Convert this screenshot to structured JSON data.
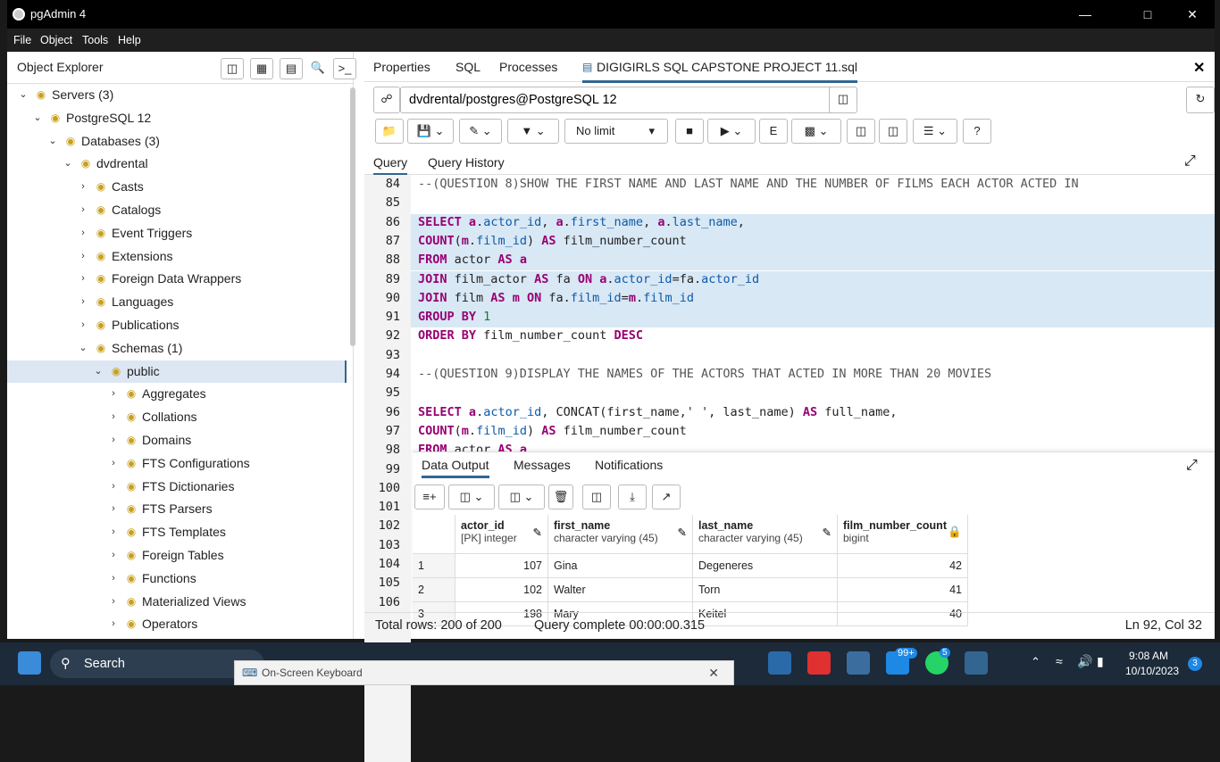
{
  "window": {
    "title": "pgAdmin 4"
  },
  "menu": [
    "File",
    "Object",
    "Tools",
    "Help"
  ],
  "explorer": {
    "title": "Object Explorer",
    "tree": [
      {
        "label": "Servers (3)",
        "depth": 0,
        "icon": "server-icon"
      },
      {
        "label": "PostgreSQL 12",
        "depth": 1,
        "icon": "elephant-icon"
      },
      {
        "label": "Databases (3)",
        "depth": 2,
        "icon": "database-icon"
      },
      {
        "label": "dvdrental",
        "depth": 3,
        "icon": "database-icon"
      },
      {
        "label": "Casts",
        "depth": 4,
        "icon": "cast-icon"
      },
      {
        "label": "Catalogs",
        "depth": 4,
        "icon": "catalog-icon"
      },
      {
        "label": "Event Triggers",
        "depth": 4,
        "icon": "event-trigger-icon"
      },
      {
        "label": "Extensions",
        "depth": 4,
        "icon": "extension-icon"
      },
      {
        "label": "Foreign Data Wrappers",
        "depth": 4,
        "icon": "fdw-icon"
      },
      {
        "label": "Languages",
        "depth": 4,
        "icon": "language-icon"
      },
      {
        "label": "Publications",
        "depth": 4,
        "icon": "publication-icon"
      },
      {
        "label": "Schemas (1)",
        "depth": 4,
        "icon": "schema-icon"
      },
      {
        "label": "public",
        "depth": 5,
        "icon": "schema-public-icon"
      },
      {
        "label": "Aggregates",
        "depth": 6,
        "icon": "aggregate-icon"
      },
      {
        "label": "Collations",
        "depth": 6,
        "icon": "collation-icon"
      },
      {
        "label": "Domains",
        "depth": 6,
        "icon": "domain-icon"
      },
      {
        "label": "FTS Configurations",
        "depth": 6,
        "icon": "fts-config-icon"
      },
      {
        "label": "FTS Dictionaries",
        "depth": 6,
        "icon": "fts-dict-icon"
      },
      {
        "label": "FTS Parsers",
        "depth": 6,
        "icon": "fts-parser-icon"
      },
      {
        "label": "FTS Templates",
        "depth": 6,
        "icon": "fts-template-icon"
      },
      {
        "label": "Foreign Tables",
        "depth": 6,
        "icon": "foreign-table-icon"
      },
      {
        "label": "Functions",
        "depth": 6,
        "icon": "function-icon"
      },
      {
        "label": "Materialized Views",
        "depth": 6,
        "icon": "mview-icon"
      },
      {
        "label": "Operators",
        "depth": 6,
        "icon": "operator-icon"
      }
    ]
  },
  "tabs": {
    "properties": "Properties",
    "sql": "SQL",
    "processes": "Processes",
    "file": "DIGIGIRLS SQL CAPSTONE PROJECT 11.sql"
  },
  "connection": "dvdrental/postgres@PostgreSQL 12",
  "limit": "No limit",
  "query_tabs": {
    "query": "Query",
    "history": "Query History"
  },
  "editor_lines": [
    {
      "n": "84",
      "html": "<span class='cm'>--(QUESTION 8)SHOW THE FIRST NAME AND LAST NAME AND THE NUMBER OF FILMS EACH ACTOR ACTED IN</span>"
    },
    {
      "n": "85",
      "html": ""
    },
    {
      "n": "86",
      "html": "<span class='kw'>SELECT</span> <span class='kw'>a</span>.<span class='ident'>actor_id</span>, <span class='kw'>a</span>.<span class='ident'>first_name</span>, <span class='kw'>a</span>.<span class='ident'>last_name</span>,",
      "hl": true
    },
    {
      "n": "87",
      "html": "<span class='kw'>COUNT</span>(<span class='kw'>m</span>.<span class='ident'>film_id</span>) <span class='kw'>AS</span> film_number_count",
      "hl": true
    },
    {
      "n": "88",
      "html": "<span class='kw'>FROM</span> actor <span class='kw'>AS</span> <span class='kw'>a</span>",
      "hl": true
    },
    {
      "n": "89",
      "html": "<span class='kw'>JOIN</span> film_actor <span class='kw'>AS</span> fa <span class='kw'>ON</span> <span class='kw'>a</span>.<span class='ident'>actor_id</span>=fa.<span class='ident'>actor_id</span>",
      "hl": true
    },
    {
      "n": "90",
      "html": "<span class='kw'>JOIN</span> film <span class='kw'>AS</span> <span class='kw'>m</span> <span class='kw'>ON</span> fa.<span class='ident'>film_id</span>=<span class='kw'>m</span>.<span class='ident'>film_id</span>",
      "hl": true
    },
    {
      "n": "91",
      "html": "<span class='kw'>GROUP BY</span> <span style='color:#1a7a2e'>1</span>",
      "hl": true
    },
    {
      "n": "92",
      "html": "<span class='kw'>ORDER BY</span> film_number_count <span class='kw'>DESC</span>"
    },
    {
      "n": "93",
      "html": ""
    },
    {
      "n": "94",
      "html": "<span class='cm'>--(QUESTION 9)DISPLAY THE NAMES OF THE ACTORS THAT ACTED IN MORE THAN 20 MOVIES</span>"
    },
    {
      "n": "95",
      "html": ""
    },
    {
      "n": "96",
      "html": "<span class='kw'>SELECT</span> <span class='kw'>a</span>.<span class='ident'>actor_id</span>, CONCAT(first_name,' ', last_name) <span class='kw'>AS</span> full_name,"
    },
    {
      "n": "97",
      "html": "<span class='kw'>COUNT</span>(<span class='kw'>m</span>.<span class='ident'>film_id</span>) <span class='kw'>AS</span> film_number_count"
    },
    {
      "n": "98",
      "html": "<span class='kw'>FROM</span> actor <span class='kw'>AS</span> <span class='kw'>a</span>"
    }
  ],
  "gutter_more": [
    "99",
    "100",
    "101",
    "102",
    "103",
    "104",
    "105",
    "106"
  ],
  "results": {
    "tabs": {
      "output": "Data Output",
      "messages": "Messages",
      "notifications": "Notifications"
    },
    "columns": [
      {
        "name": "actor_id",
        "type": "[PK] integer"
      },
      {
        "name": "first_name",
        "type": "character varying (45)"
      },
      {
        "name": "last_name",
        "type": "character varying (45)"
      },
      {
        "name": "film_number_count",
        "type": "bigint"
      }
    ],
    "rows": [
      [
        "1",
        "107",
        "Gina",
        "Degeneres",
        "42"
      ],
      [
        "2",
        "102",
        "Walter",
        "Torn",
        "41"
      ],
      [
        "3",
        "198",
        "Mary",
        "Keitel",
        "40"
      ]
    ]
  },
  "status": {
    "rows": "Total rows: 200 of 200",
    "query": "Query complete 00:00:00.315",
    "pos": "Ln 92, Col 32"
  },
  "taskbar": {
    "search": "Search",
    "osk": "On-Screen Keyboard",
    "time": "9:08 AM",
    "date": "10/10/2023",
    "badge_mail": "99+",
    "badge_wa": "5",
    "notif": "3"
  }
}
